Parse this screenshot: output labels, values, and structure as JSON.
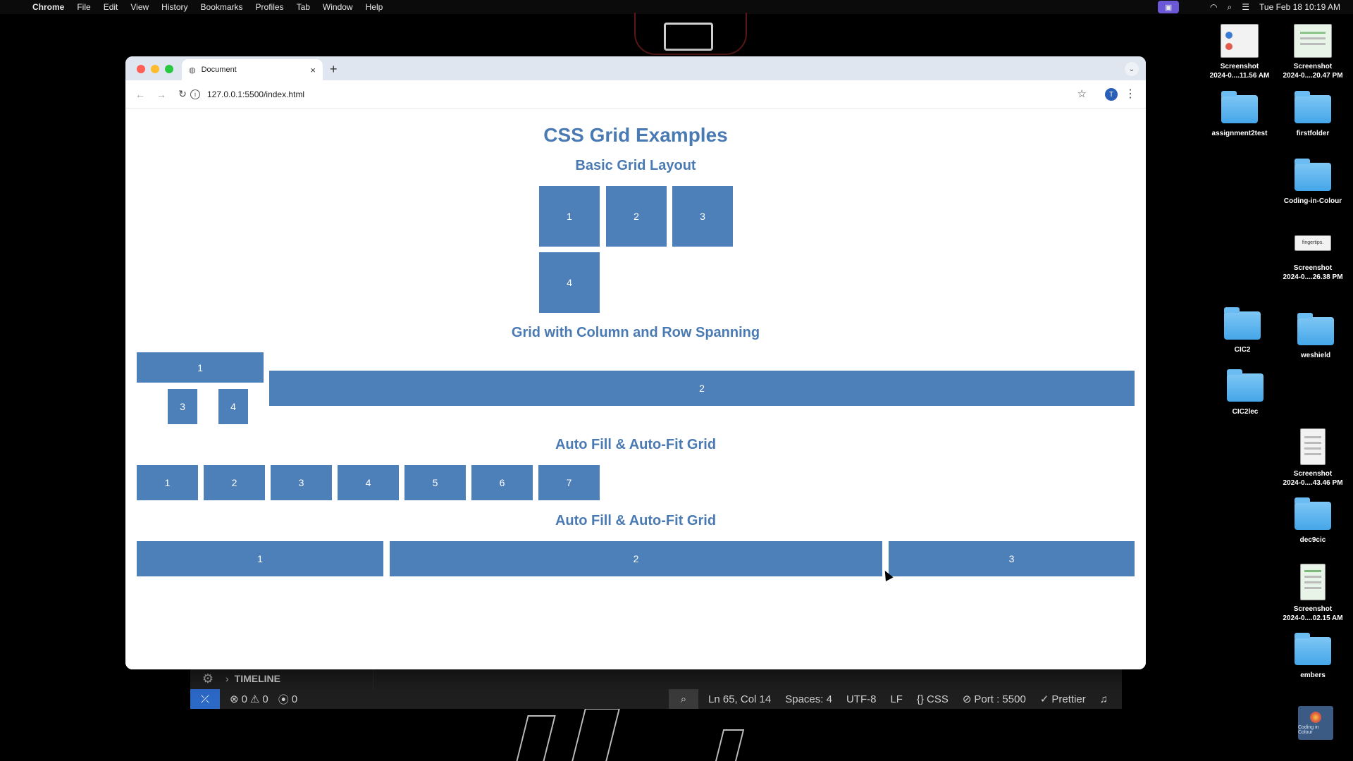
{
  "menubar": {
    "app": "Chrome",
    "menus": [
      "File",
      "Edit",
      "View",
      "History",
      "Bookmarks",
      "Profiles",
      "Tab",
      "Window",
      "Help"
    ],
    "datetime": "Tue Feb 18  10:19 AM"
  },
  "desktop": {
    "icons": [
      {
        "label": "Screenshot\n2024-0....11.56 AM",
        "kind": "thumb"
      },
      {
        "label": "Screenshot\n2024-0....20.47 PM",
        "kind": "thumb"
      },
      {
        "label": "assignment2test",
        "kind": "folder"
      },
      {
        "label": "firstfolder",
        "kind": "folder"
      },
      {
        "label": "Coding-in-Colour",
        "kind": "folder"
      },
      {
        "label": "Screenshot\n2024-0....26.38 PM",
        "kind": "thumb"
      },
      {
        "label": "CIC2",
        "kind": "folder"
      },
      {
        "label": "weshield",
        "kind": "folder"
      },
      {
        "label": "CIC2lec",
        "kind": "folder"
      },
      {
        "label": "Screenshot\n2024-0....43.46 PM",
        "kind": "thumb"
      },
      {
        "label": "dec9cic",
        "kind": "folder"
      },
      {
        "label": "Screenshot\n2024-0....02.15 AM",
        "kind": "thumb"
      },
      {
        "label": "embers",
        "kind": "folder"
      }
    ],
    "thumb_fingertips_text": "fingertips.",
    "coding_tile_text": "Coding in Colour"
  },
  "browser": {
    "tab_title": "Document",
    "url": "127.0.0.1:5500/index.html",
    "profile_initial": "T"
  },
  "page": {
    "title": "CSS Grid Examples",
    "sections": [
      {
        "heading": "Basic Grid Layout",
        "items": [
          "1",
          "2",
          "3",
          "4"
        ]
      },
      {
        "heading": "Grid with Column and Row Spanning",
        "items": [
          "1",
          "2",
          "3",
          "4"
        ]
      },
      {
        "heading": "Auto Fill & Auto-Fit Grid",
        "items": [
          "1",
          "2",
          "3",
          "4",
          "5",
          "6",
          "7"
        ]
      },
      {
        "heading": "Auto Fill & Auto-Fit Grid",
        "items": [
          "1",
          "2",
          "3"
        ]
      }
    ]
  },
  "vscode": {
    "timeline_label": "TIMELINE",
    "errors": "0",
    "warnings": "0",
    "ports": "0",
    "position": "Ln 65, Col 14",
    "spaces": "Spaces: 4",
    "encoding": "UTF-8",
    "eol": "LF",
    "language": "CSS",
    "port": "Port : 5500",
    "formatter": "Prettier"
  },
  "colors": {
    "cell": "#4d7fb8",
    "heading": "#4a7ab3",
    "remote": "#2c68c6"
  }
}
